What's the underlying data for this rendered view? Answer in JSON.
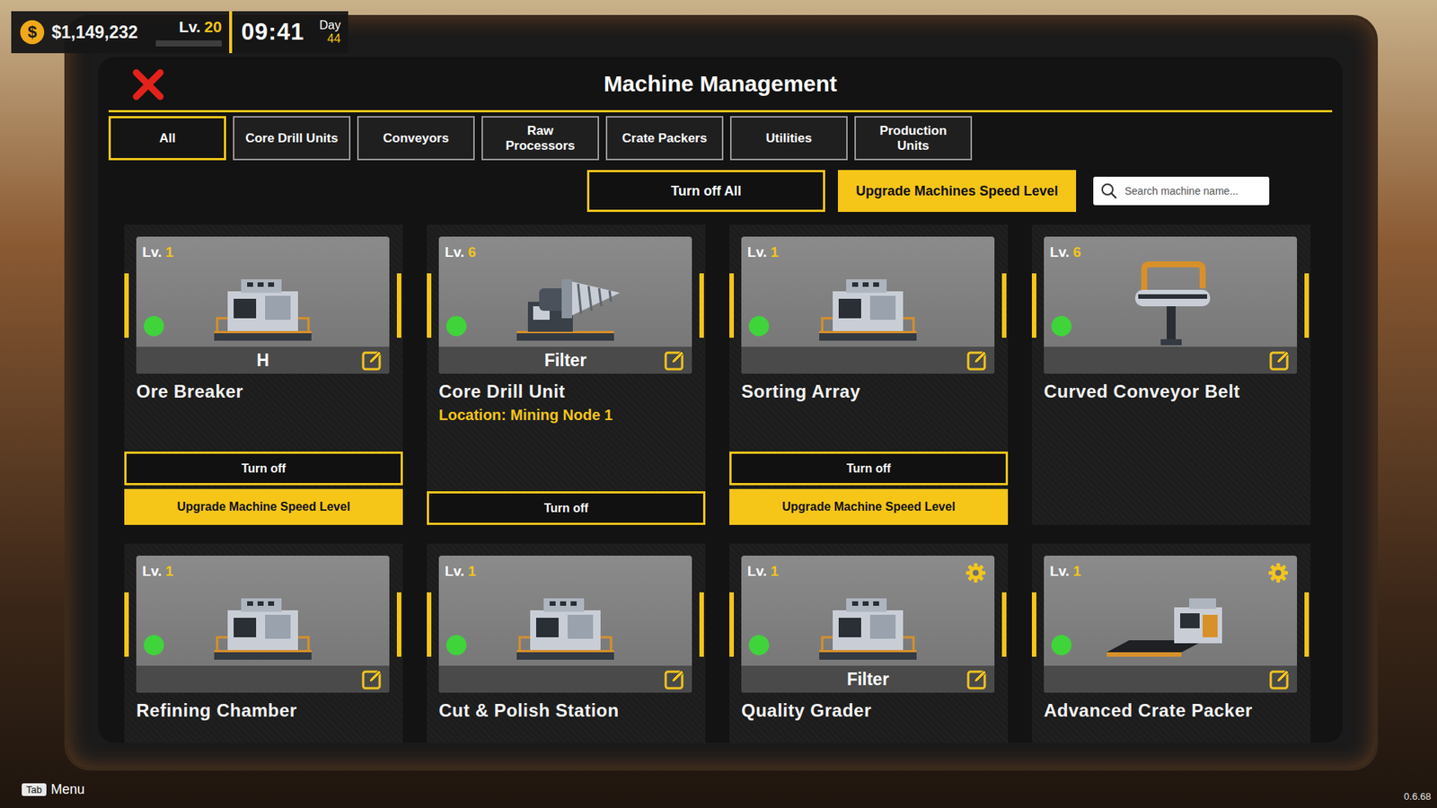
{
  "hud": {
    "coin": "$",
    "money": "$1,149,232",
    "level_label": "Lv.",
    "level": "20",
    "xp_level": 0,
    "time": "09:41",
    "day_label": "Day",
    "day": "44"
  },
  "panel": {
    "title": "Machine Management"
  },
  "tabs": [
    {
      "label": "All",
      "selected": true
    },
    {
      "label": "Core Drill Units",
      "selected": false
    },
    {
      "label": "Conveyors",
      "selected": false
    },
    {
      "label": "Raw Processors",
      "selected": false
    },
    {
      "label": "Crate Packers",
      "selected": false
    },
    {
      "label": "Utilities",
      "selected": false
    },
    {
      "label": "Production Units",
      "selected": false
    }
  ],
  "actions": {
    "turn_off_all": "Turn off All",
    "upgrade_all": "Upgrade Machines Speed Level"
  },
  "search": {
    "placeholder": "Search machine name..."
  },
  "machines": [
    {
      "level_label": "Lv.",
      "level": "1",
      "name": "Ore Breaker",
      "kind": "machine",
      "tag": "H",
      "on": true,
      "settings": false,
      "buttons": [
        {
          "label": "Turn off",
          "kind": "outline"
        },
        {
          "label": "Upgrade Machine Speed Level",
          "kind": "filled"
        }
      ]
    },
    {
      "level_label": "Lv.",
      "level": "6",
      "name": "Core Drill Unit",
      "kind": "drill",
      "tag": "Filter",
      "location": "Location: Mining Node 1",
      "on": true,
      "settings": false,
      "buttons": [
        {
          "label": "Turn off",
          "kind": "outline"
        }
      ]
    },
    {
      "level_label": "Lv.",
      "level": "1",
      "name": "Sorting Array",
      "kind": "machine",
      "tag": "",
      "on": true,
      "settings": false,
      "buttons": [
        {
          "label": "Turn off",
          "kind": "outline"
        },
        {
          "label": "Upgrade Machine Speed Level",
          "kind": "filled"
        }
      ]
    },
    {
      "level_label": "Lv.",
      "level": "6",
      "name": "Curved Conveyor Belt",
      "kind": "conveyor",
      "tag": "",
      "on": true,
      "settings": false,
      "buttons": []
    },
    {
      "level_label": "Lv.",
      "level": "1",
      "name": "Refining Chamber",
      "kind": "machine",
      "tag": "",
      "on": true,
      "settings": false,
      "buttons": []
    },
    {
      "level_label": "Lv.",
      "level": "1",
      "name": "Cut & Polish Station",
      "kind": "machine",
      "tag": "",
      "on": true,
      "settings": false,
      "buttons": []
    },
    {
      "level_label": "Lv.",
      "level": "1",
      "name": "Quality Grader",
      "kind": "machine",
      "tag": "Filter",
      "on": true,
      "settings": true,
      "buttons": []
    },
    {
      "level_label": "Lv.",
      "level": "1",
      "name": "Advanced Crate Packer",
      "kind": "packer",
      "tag": "",
      "on": true,
      "settings": true,
      "buttons": []
    }
  ],
  "footer": {
    "key": "Tab",
    "label": "Menu",
    "version": "0.6.68"
  }
}
